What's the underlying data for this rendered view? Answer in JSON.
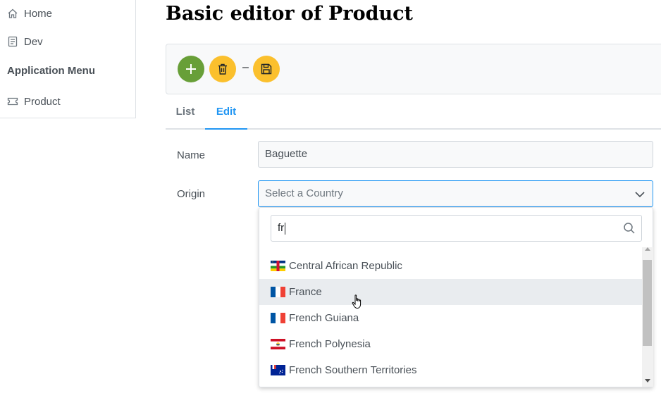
{
  "sidebar": {
    "items": [
      {
        "label": "Home",
        "icon": "home-icon"
      },
      {
        "label": "Dev",
        "icon": "book-icon"
      }
    ],
    "section_header": "Application Menu",
    "section_items": [
      {
        "label": "Product",
        "icon": "ticket-icon"
      }
    ]
  },
  "page": {
    "title": "Basic editor of Product"
  },
  "toolbar": {
    "add_icon": "plus-icon",
    "delete_icon": "trash-icon",
    "separator": "–",
    "save_icon": "save-icon",
    "colors": {
      "add": "#689f38",
      "warning": "#fbc02d"
    }
  },
  "tabs": [
    {
      "label": "List",
      "active": false
    },
    {
      "label": "Edit",
      "active": true
    }
  ],
  "form": {
    "name_label": "Name",
    "name_value": "Baguette",
    "origin_label": "Origin",
    "origin_placeholder": "Select a Country"
  },
  "dropdown": {
    "filter_value": "fr",
    "options": [
      {
        "label": "Central African Republic",
        "flag": "cf"
      },
      {
        "label": "France",
        "flag": "fr",
        "hovered": true
      },
      {
        "label": "French Guiana",
        "flag": "gf"
      },
      {
        "label": "French Polynesia",
        "flag": "pf"
      },
      {
        "label": "French Southern Territories",
        "flag": "tf"
      }
    ]
  },
  "accent_color": "#2196f3"
}
